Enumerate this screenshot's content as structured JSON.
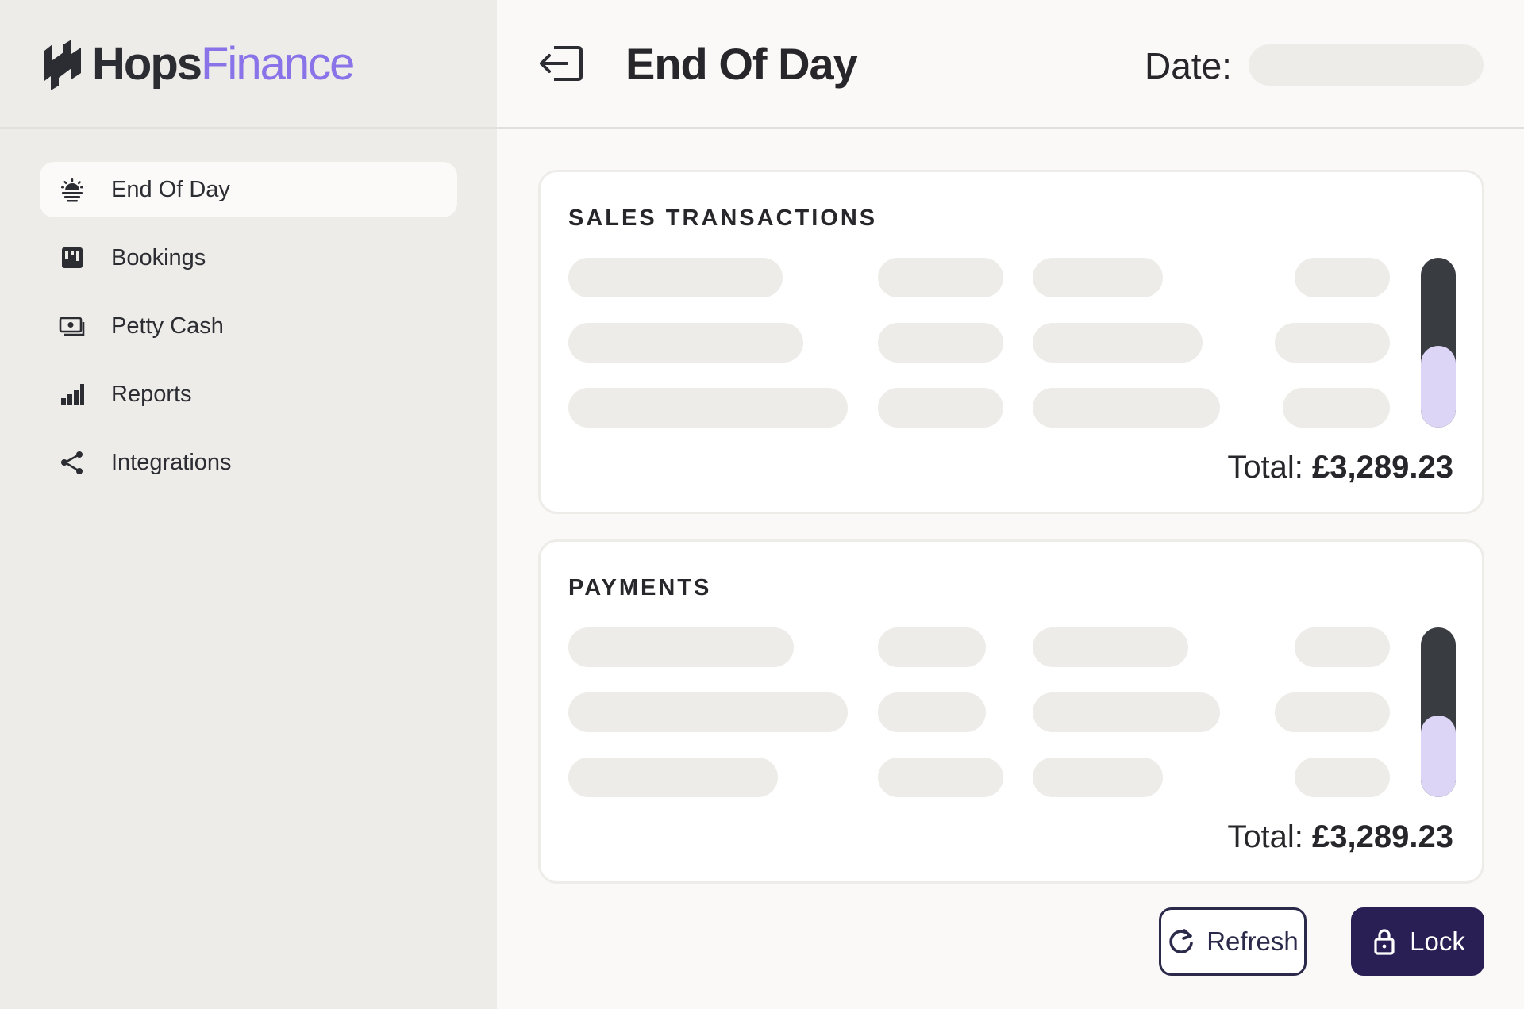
{
  "brand": {
    "name_primary": "Hops",
    "name_secondary": "Finance",
    "accent_color": "#8a72e8",
    "logo_icon": "hops-logo-icon"
  },
  "sidebar": {
    "items": [
      {
        "label": "End Of Day",
        "icon": "sunrise-icon",
        "active": true
      },
      {
        "label": "Bookings",
        "icon": "kanban-board-icon",
        "active": false
      },
      {
        "label": "Petty Cash",
        "icon": "cash-icon",
        "active": false
      },
      {
        "label": "Reports",
        "icon": "bar-chart-icon",
        "active": false
      },
      {
        "label": "Integrations",
        "icon": "share-nodes-icon",
        "active": false
      }
    ]
  },
  "header": {
    "back_icon": "exit-arrow-icon",
    "title": "End Of Day",
    "date_label": "Date:",
    "date_value": ""
  },
  "sales": {
    "title": "SALES TRANSACTIONS",
    "total_label": "Total:",
    "total_value": "£3,289.23",
    "scroll_position": 0.48
  },
  "payments": {
    "title": "PAYMENTS",
    "total_label": "Total:",
    "total_value": "£3,289.23",
    "scroll_position": 0.48
  },
  "actions": {
    "refresh_label": "Refresh",
    "refresh_icon": "refresh-icon",
    "lock_label": "Lock",
    "lock_icon": "lock-icon"
  },
  "colors": {
    "sidebar_bg": "#eeece8",
    "primary_dark": "#2a1f55",
    "scroll_track": "#393c40",
    "scroll_thumb": "#ddd5f6"
  }
}
